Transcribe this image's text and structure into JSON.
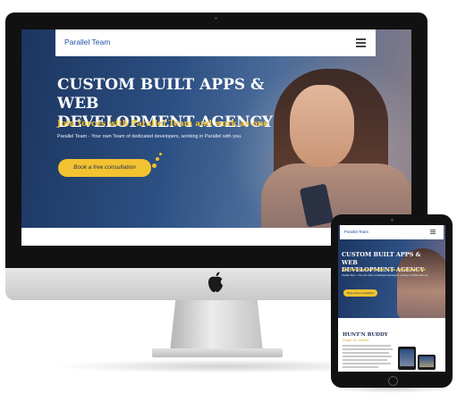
{
  "desktop": {
    "brand": "Parallel Team",
    "menu_icon": "hamburger-menu-icon",
    "headline_line1": "CUSTOM BUILT APPS & WEB",
    "headline_line2": "DEVELOPMENT AGENCY",
    "subheadline": "Join forces with Parallel Team and work as one",
    "tagline": "Parallel Team - Your own Team of dedicated developers, working in Parallel with you.",
    "cta_label": "Book a free consultation"
  },
  "tablet": {
    "brand": "Parallel Team",
    "headline_line1": "CUSTOM BUILT APPS & WEB",
    "headline_line2": "DEVELOPMENT AGENCY",
    "subheadline": "Join forces with Parallel Team and work as one",
    "tagline": "Parallel Team - Your own Team of dedicated developers, working in Parallel with you.",
    "cta_label": "Book a free consultation",
    "section_title": "HUNT'N BUDDY",
    "section_subtitle": "Design. UX. Android."
  },
  "colors": {
    "accent": "#f2c230",
    "brand_blue": "#1e4fa8",
    "hero_navy": "#1c3560"
  },
  "icons": {
    "apple": "apple-logo-icon",
    "menu": "hamburger-menu-icon"
  }
}
